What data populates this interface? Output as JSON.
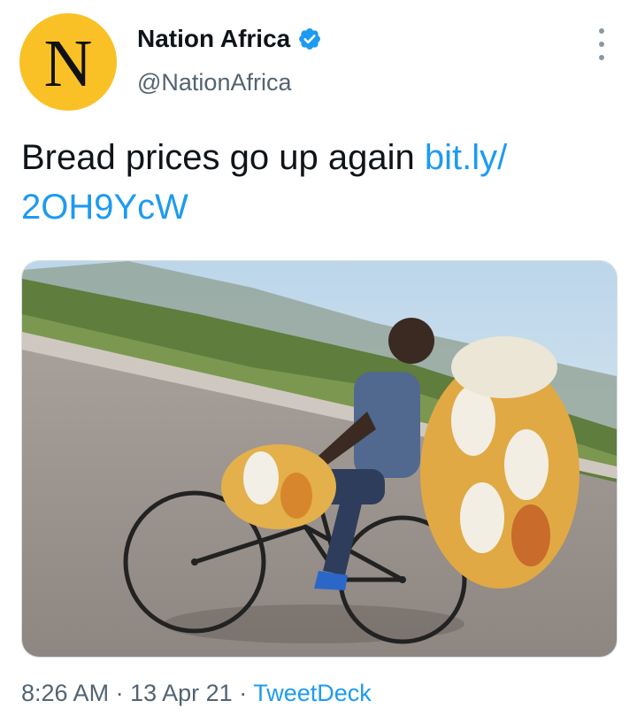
{
  "account": {
    "avatar_letter": "N",
    "avatar_color": "#f9c125",
    "name": "Nation Africa",
    "handle": "@NationAfrica",
    "verified": true,
    "verified_icon": "verified-badge-icon"
  },
  "tweet": {
    "text": "Bread prices go up again",
    "link": "bit.ly/ 2OH9YcW",
    "link_color": "#1d9bf0",
    "media_icon": "photo-man-on-bicycle-carrying-bread"
  },
  "meta": {
    "time": "8:26 AM",
    "date": "13 Apr 21",
    "separator": "·",
    "source": "TweetDeck"
  },
  "menu_icon": "more-options-icon"
}
